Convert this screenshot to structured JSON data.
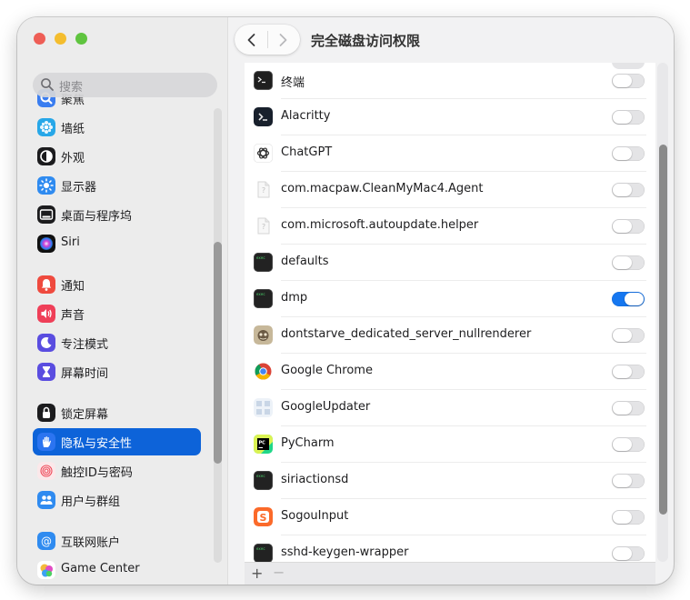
{
  "window": {
    "title": "完全磁盘访问权限"
  },
  "search": {
    "placeholder": "搜索"
  },
  "sidebar": {
    "items": [
      {
        "label": "聚焦",
        "icon": "spotlight-icon"
      },
      {
        "label": "墙纸",
        "icon": "wallpaper-icon"
      },
      {
        "label": "外观",
        "icon": "appearance-icon"
      },
      {
        "label": "显示器",
        "icon": "displays-icon"
      },
      {
        "label": "桌面与程序坞",
        "icon": "desktop-dock-icon"
      },
      {
        "label": "Siri",
        "icon": "siri-icon"
      },
      {
        "label": "通知",
        "icon": "notifications-icon"
      },
      {
        "label": "声音",
        "icon": "sound-icon"
      },
      {
        "label": "专注模式",
        "icon": "focus-icon"
      },
      {
        "label": "屏幕时间",
        "icon": "screen-time-icon"
      },
      {
        "label": "锁定屏幕",
        "icon": "lock-screen-icon"
      },
      {
        "label": "隐私与安全性",
        "icon": "privacy-hand-icon",
        "selected": true
      },
      {
        "label": "触控ID与密码",
        "icon": "fingerprint-icon"
      },
      {
        "label": "用户与群组",
        "icon": "users-groups-icon"
      },
      {
        "label": "互联网账户",
        "icon": "internet-accounts-icon"
      },
      {
        "label": "Game Center",
        "icon": "game-center-icon"
      }
    ]
  },
  "apps": [
    {
      "name": "终端",
      "icon": "terminal-icon",
      "enabled": false
    },
    {
      "name": "Alacritty",
      "icon": "alacritty-icon",
      "enabled": false
    },
    {
      "name": "ChatGPT",
      "icon": "chatgpt-icon",
      "enabled": false
    },
    {
      "name": "com.macpaw.CleanMyMac4.Agent",
      "icon": "generic-document-icon",
      "enabled": false
    },
    {
      "name": "com.microsoft.autoupdate.helper",
      "icon": "generic-document-icon",
      "enabled": false
    },
    {
      "name": "defaults",
      "icon": "exec-terminal-icon",
      "enabled": false
    },
    {
      "name": "dmp",
      "icon": "exec-terminal-icon",
      "enabled": true
    },
    {
      "name": "dontstarve_dedicated_server_nullrenderer",
      "icon": "dontstarve-icon",
      "enabled": false
    },
    {
      "name": "Google Chrome",
      "icon": "chrome-icon",
      "enabled": false
    },
    {
      "name": "GoogleUpdater",
      "icon": "google-updater-icon",
      "enabled": false
    },
    {
      "name": "PyCharm",
      "icon": "pycharm-icon",
      "enabled": false
    },
    {
      "name": "siriactionsd",
      "icon": "exec-terminal-icon",
      "enabled": false
    },
    {
      "name": "SogouInput",
      "icon": "sogou-icon",
      "enabled": false
    },
    {
      "name": "sshd-keygen-wrapper",
      "icon": "exec-terminal-icon",
      "enabled": false
    }
  ],
  "footer": {
    "add_label": "+",
    "remove_label": "−"
  },
  "colors": {
    "accent": "#0d63d9",
    "toggle_on": "#1677f0"
  }
}
